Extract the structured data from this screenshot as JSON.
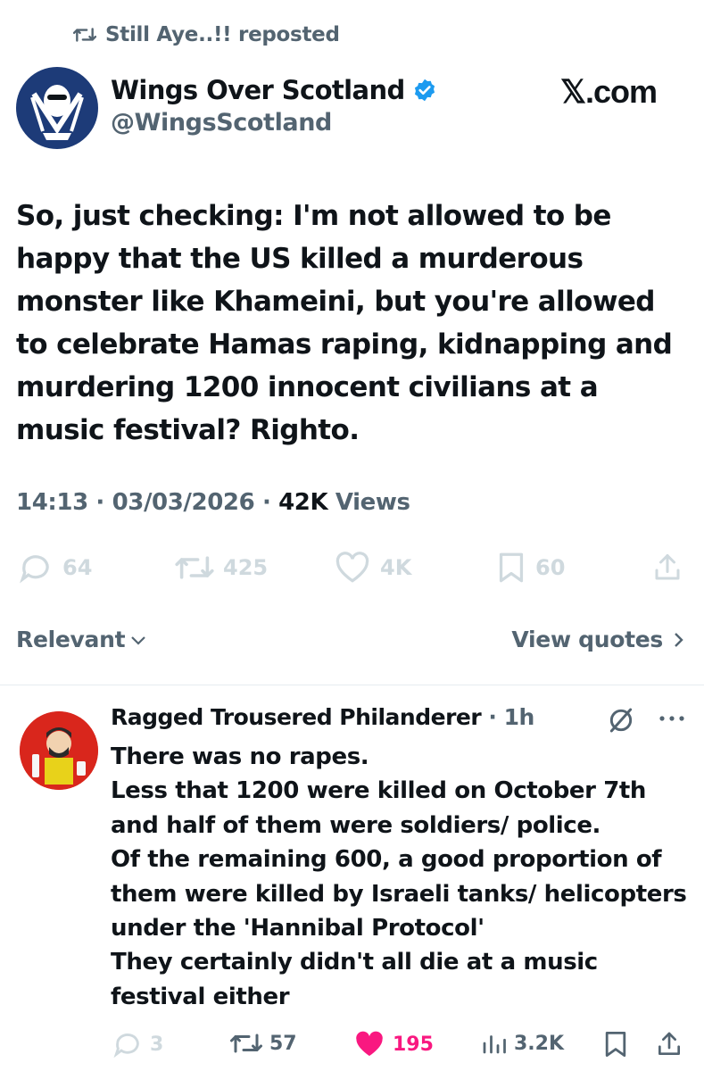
{
  "repost": {
    "label": "Still Aye..!! reposted"
  },
  "tweet": {
    "author_name": "Wings Over Scotland",
    "handle": "@WingsScotland",
    "source_watermark": "𝕏.com",
    "text": "So, just checking: I'm not allowed to be happy that the US killed a murderous monster like Khameini, but you're allowed to celebrate Hamas raping, kidnapping and murdering 1200 innocent civilians at a music festival? Righto.",
    "time": "14:13",
    "date": "03/03/2026",
    "views_count": "42K",
    "views_label": "Views",
    "sep": "·",
    "actions": {
      "replies": "64",
      "reposts": "425",
      "likes": "4K",
      "bookmarks": "60"
    }
  },
  "filters": {
    "sort_label": "Relevant",
    "quotes_label": "View quotes"
  },
  "reply": {
    "author_name": "Ragged Trousered Philanderer",
    "sep": "·",
    "time": "1h",
    "lines": [
      "There was no rapes.",
      "Less that 1200 were killed on October 7th and half of them were soldiers/ police.",
      "Of the remaining 600, a good proportion of them were killed by Israeli tanks/ helicopters under the 'Hannibal Protocol'",
      "They certainly didn't all die at a music festival either"
    ],
    "actions": {
      "replies": "3",
      "reposts": "57",
      "likes": "195",
      "views": "3.2K"
    }
  },
  "colors": {
    "text": "#0f1419",
    "secondary": "#536471",
    "faded": "#cfd9de",
    "verified_blue": "#1d9bf0",
    "like_pink": "#f91880"
  }
}
